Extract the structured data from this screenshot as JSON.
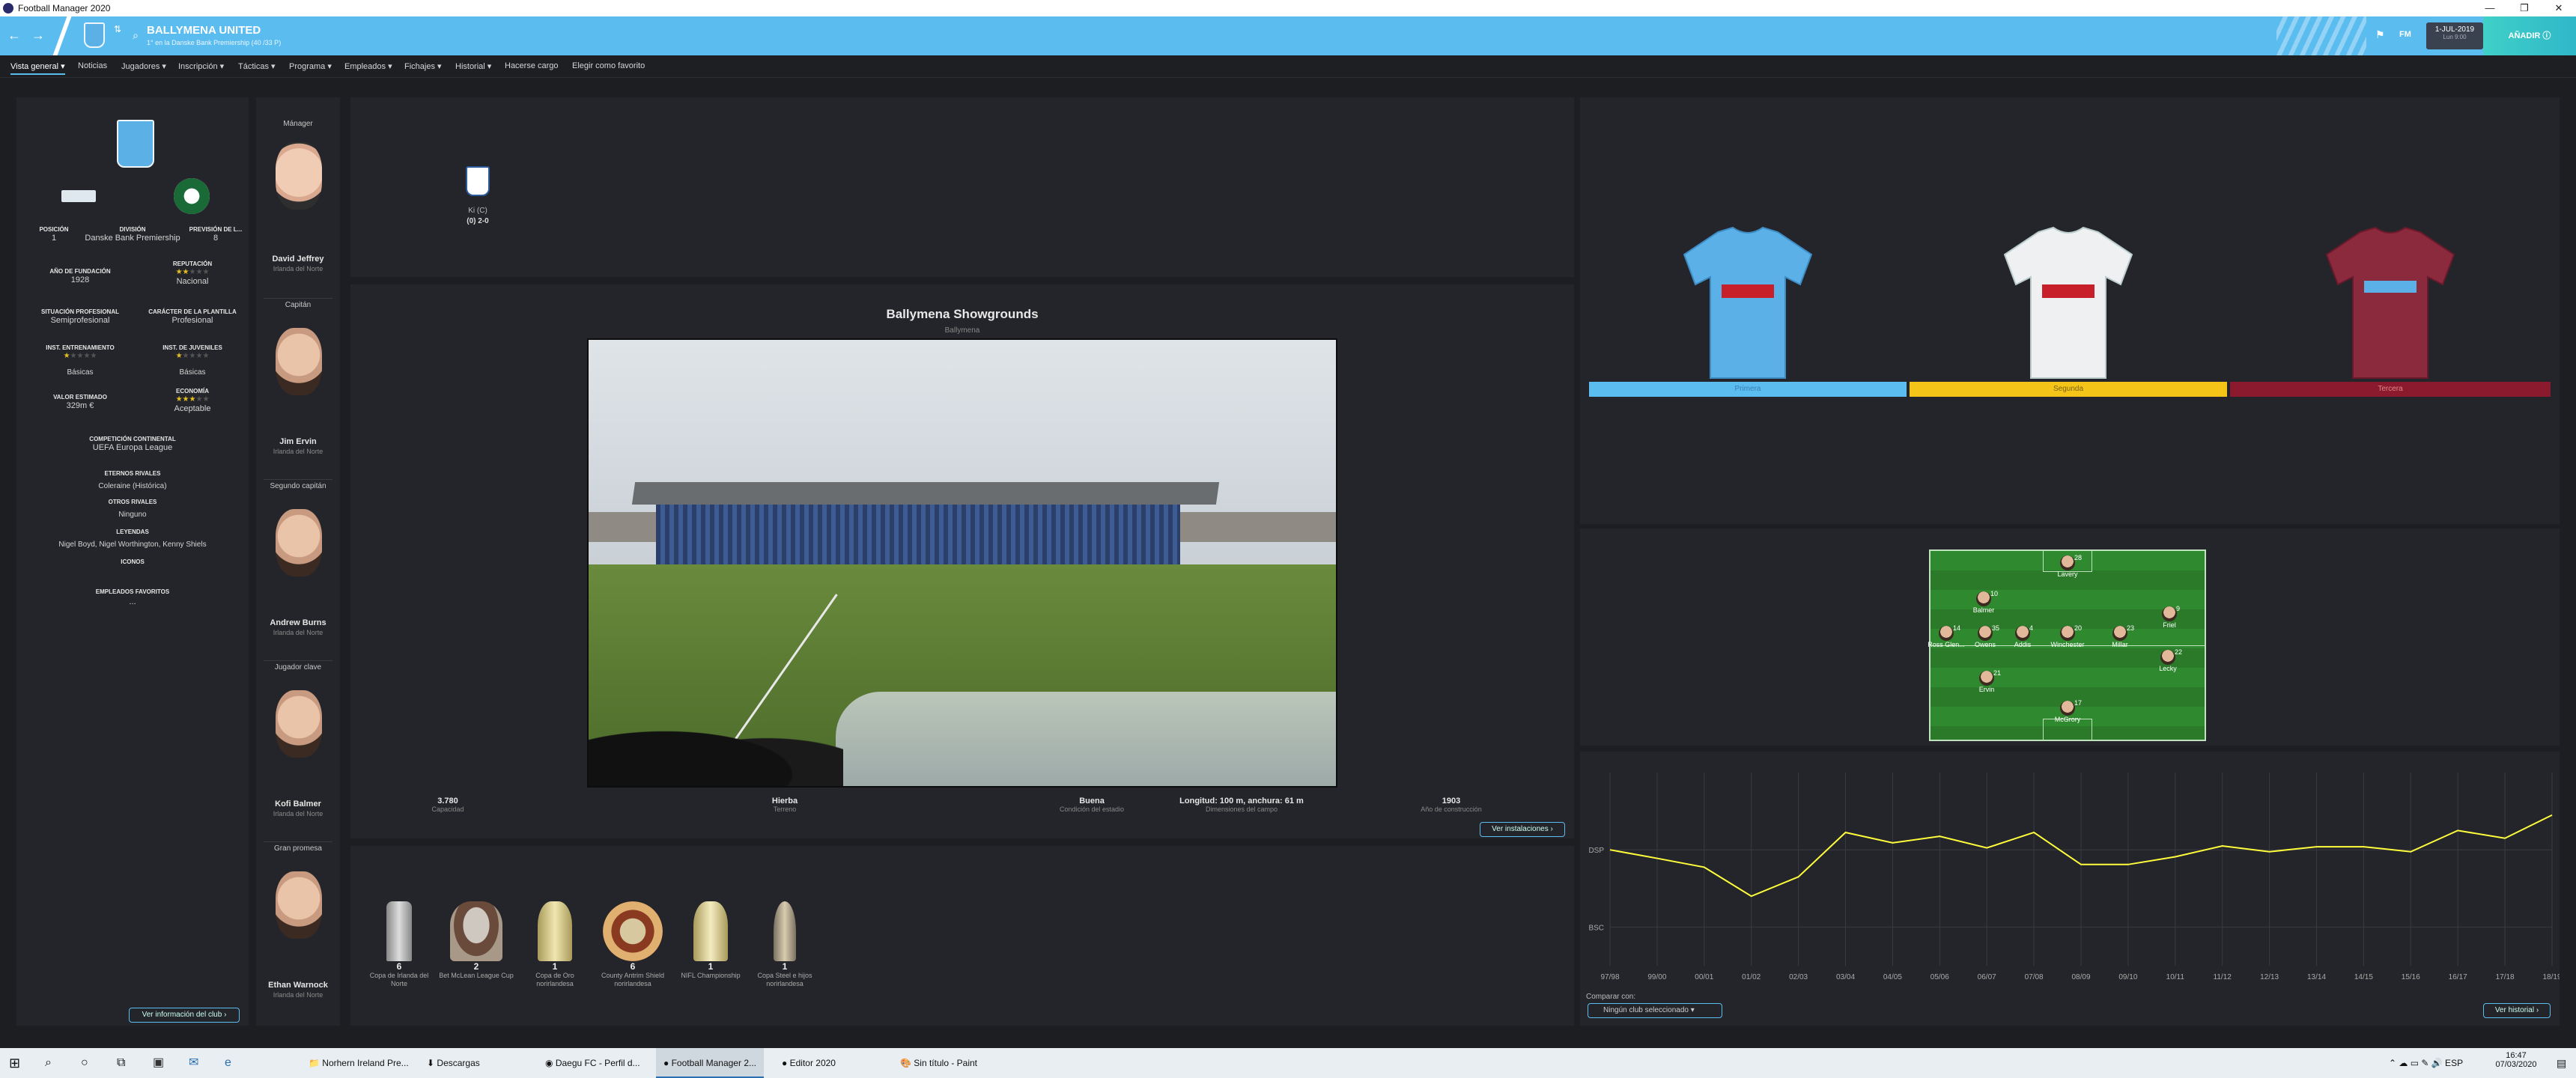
{
  "window": {
    "title": "Football Manager 2020",
    "min": "—",
    "max": "❐",
    "close": "✕"
  },
  "header": {
    "club_name": "BALLYMENA UNITED",
    "club_sub": "1° en la Danske Bank Premiership (40 /33 P)",
    "date_line1": "1-JUL-2019",
    "date_line2": "Lun 9:00",
    "continue_label": "AÑADIR",
    "fm_label": "FM"
  },
  "menu": [
    "Vista general",
    "Noticias",
    "Jugadores",
    "Inscripción",
    "Tácticas",
    "Programa",
    "Empleados",
    "Fichajes",
    "Historial",
    "Hacerse cargo",
    "Elegir como favorito"
  ],
  "club_info": {
    "position_label": "POSICIÓN",
    "position": "1",
    "division_label": "DIVISIÓN",
    "division": "Danske Bank Premiership",
    "forecast_label": "PREVISIÓN DE L...",
    "forecast": "8",
    "founded_label": "AÑO DE FUNDACIÓN",
    "founded": "1928",
    "reputation_label": "REPUTACIÓN",
    "reputation": "Nacional",
    "reputation_stars": 2,
    "prof_label": "SITUACIÓN PROFESIONAL",
    "prof": "Semiprofesional",
    "squad_label": "CARÁCTER DE LA PLANTILLA",
    "squad": "Profesional",
    "training_label": "INST. ENTRENAMIENTO",
    "training": "Básicas",
    "training_stars": 1,
    "youth_label": "INST. DE JUVENILES",
    "youth": "Básicas",
    "youth_stars": 1,
    "value_label": "VALOR ESTIMADO",
    "value": "329m €",
    "economy_label": "ECONOMÍA",
    "economy": "Aceptable",
    "economy_stars": 3,
    "cont_label": "COMPETICIÓN CONTINENTAL",
    "cont": "UEFA Europa League",
    "eternal_label": "ETERNOS RIVALES",
    "eternal": "Coleraine (Histórica)",
    "other_label": "OTROS RIVALES",
    "other": "Ninguno",
    "legends_label": "LEYENDAS",
    "legends": "Nigel Boyd, Nigel Worthington, Kenny Shiels",
    "icons_label": "ICONOS",
    "icons": "",
    "fav_label": "EMPLEADOS FAVORITOS",
    "fav": "...",
    "more_button": "Ver información del club"
  },
  "people": [
    {
      "role": "Mánager",
      "name": "David Jeffrey",
      "nation": "Irlanda del Norte"
    },
    {
      "role": "Capitán",
      "name": "Jim Ervin",
      "nation": "Irlanda del Norte"
    },
    {
      "role": "Segundo capitán",
      "name": "Andrew Burns",
      "nation": "Irlanda del Norte"
    },
    {
      "role": "Jugador clave",
      "name": "Kofi Balmer",
      "nation": "Irlanda del Norte"
    },
    {
      "role": "Gran promesa",
      "name": "Ethan Warnock",
      "nation": "Irlanda del Norte"
    }
  ],
  "last_match": {
    "label": "Ki (C)",
    "score": "(0) 2-0"
  },
  "stadium": {
    "name": "Ballymena Showgrounds",
    "city": "Ballymena",
    "stats": [
      {
        "value": "3.780",
        "label": "Capacidad"
      },
      {
        "value": "Hierba",
        "label": "Terreno"
      },
      {
        "value": "Buena",
        "label": "Condición del estadio"
      },
      {
        "value": "Longitud: 100 m, anchura: 61 m",
        "label": "Dimensiones del campo"
      },
      {
        "value": "1903",
        "label": "Año de construcción"
      }
    ],
    "button": "Ver instalaciones"
  },
  "trophies": [
    {
      "count": "6",
      "name": "Copa de Irlanda del Norte"
    },
    {
      "count": "2",
      "name": "Bet McLean League Cup"
    },
    {
      "count": "1",
      "name": "Copa de Oro norirlandesa"
    },
    {
      "count": "6",
      "name": "County Antrim Shield norirlandesa"
    },
    {
      "count": "1",
      "name": "NIFL Championship"
    },
    {
      "count": "1",
      "name": "Copa Steel e hijos norirlandesa"
    }
  ],
  "kits": [
    {
      "label": "Primera",
      "bar": "#5bbcf0",
      "text": "#3a7fb0"
    },
    {
      "label": "Segunda",
      "bar": "#f4c518",
      "text": "#7a6210"
    },
    {
      "label": "Tercera",
      "bar": "#8c1a2e",
      "text": "#d88"
    }
  ],
  "formation": [
    {
      "name": "Lavery",
      "num": "28"
    },
    {
      "name": "Balmer",
      "num": "10"
    },
    {
      "name": "Ross Glen...",
      "num": "14"
    },
    {
      "name": "Owens",
      "num": "35"
    },
    {
      "name": "Addis",
      "num": "4"
    },
    {
      "name": "Winchester",
      "num": "20"
    },
    {
      "name": "Millar",
      "num": "23"
    },
    {
      "name": "Friel",
      "num": "9"
    },
    {
      "name": "Lecky",
      "num": "22"
    },
    {
      "name": "Ervin",
      "num": "21"
    },
    {
      "name": "McGrory",
      "num": "17"
    }
  ],
  "chart_data": {
    "type": "line",
    "x": [
      "97/98",
      "99/00",
      "00/01",
      "01/02",
      "02/03",
      "03/04",
      "04/05",
      "05/06",
      "06/07",
      "07/08",
      "08/09",
      "09/10",
      "10/11",
      "11/12",
      "12/13",
      "13/14",
      "14/15",
      "15/16",
      "16/17",
      "17/18",
      "18/19"
    ],
    "y_levels": [
      "DSP",
      "BSC"
    ],
    "values": [
      1.0,
      0.78,
      0.55,
      -0.2,
      0.3,
      1.45,
      1.18,
      1.35,
      1.05,
      1.45,
      0.62,
      0.62,
      0.82,
      1.1,
      0.95,
      1.08,
      1.08,
      0.95,
      1.5,
      1.3,
      1.9
    ],
    "ylim": [
      -2,
      3
    ],
    "grid": true,
    "color": "#ffff3c"
  },
  "history": {
    "compare_label": "Comparar con:",
    "compare_value": "Ningún club seleccionado",
    "button": "Ver historial"
  },
  "taskbar": {
    "items": [
      "Norhern Ireland Pre...",
      "Descargas",
      "Daegu FC - Perfil d...",
      "Football Manager 2...",
      "Editor 2020",
      "Sin título - Paint"
    ],
    "time": "16:47",
    "date": "07/03/2020"
  }
}
